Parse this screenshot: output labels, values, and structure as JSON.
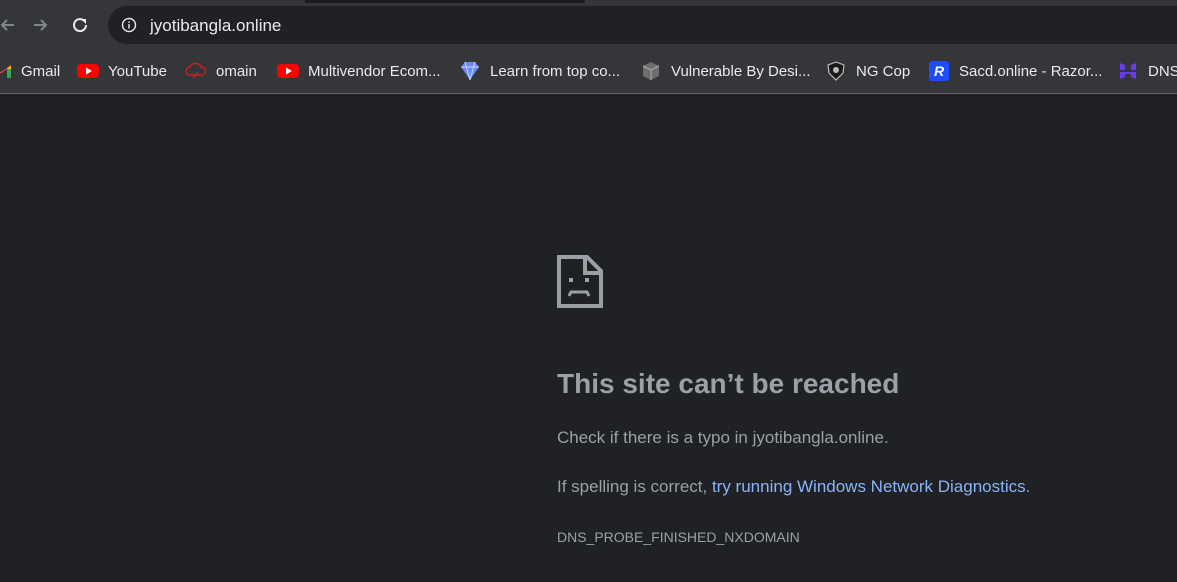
{
  "browser": {
    "url": "jyotibangla.online"
  },
  "bookmarks": [
    {
      "label": "Gmail",
      "icon": "gmail-icon"
    },
    {
      "label": "YouTube",
      "icon": "youtube-icon"
    },
    {
      "label": "omain",
      "icon": "cloud-icon"
    },
    {
      "label": "Multivendor Ecom...",
      "icon": "youtube-icon"
    },
    {
      "label": "Learn from top co...",
      "icon": "diamond-icon"
    },
    {
      "label": "Vulnerable By Desi...",
      "icon": "cube-icon"
    },
    {
      "label": "NG Cop",
      "icon": "shield-icon"
    },
    {
      "label": "Sacd.online - Razor...",
      "icon": "razorpay-icon"
    },
    {
      "label": "DNS",
      "icon": "hostinger-icon"
    }
  ],
  "error": {
    "title": "This site can’t be reached",
    "line1": "Check if there is a typo in jyotibangla.online.",
    "line2_prefix": "If spelling is correct, ",
    "line2_link": "try running Windows Network Diagnostics",
    "line2_suffix": ".",
    "code": "DNS_PROBE_FINISHED_NXDOMAIN"
  },
  "colors": {
    "background": "#202124",
    "toolbar": "#35363a",
    "text_muted": "#9aa0a6",
    "link": "#8ab4f8",
    "youtube_red": "#ff0000",
    "razorpay_blue": "#1b4cff",
    "hostinger_purple": "#673de6"
  }
}
